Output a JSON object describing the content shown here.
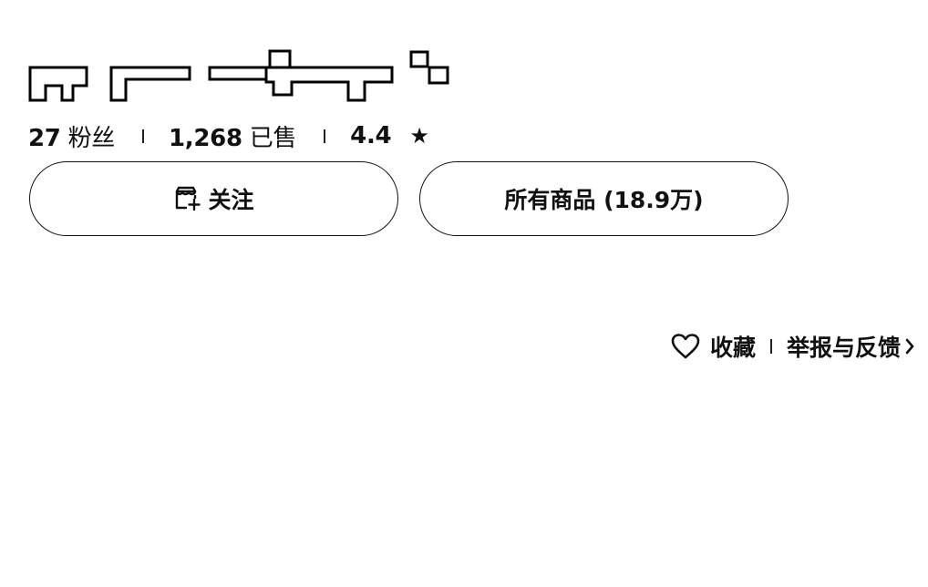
{
  "shop": {
    "logo_icon": "censored-store-name-icon"
  },
  "stats": {
    "followers_value": "27",
    "followers_label": "粉丝",
    "sold_value": "1,268",
    "sold_label": "已售",
    "rating_value": "4.4",
    "rating_star": "★"
  },
  "buttons": {
    "follow_label": "关注",
    "follow_icon": "follow-store-icon",
    "all_products_label": "所有商品 (18.9万)"
  },
  "actions": {
    "favorite_label": "收藏",
    "favorite_icon": "heart-icon",
    "report_label": "举报与反馈",
    "report_icon": "chevron-right-icon"
  }
}
